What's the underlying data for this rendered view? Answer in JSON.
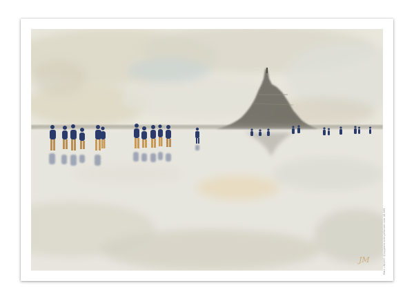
{
  "artwork": {
    "subject": "watercolor-mont-saint-michel-bay-walkers",
    "credit_text": "Matt LINDSEY  @juggeem  lorenyellonder.com  48 869",
    "signature": "JM",
    "palette": {
      "paper": "#ffffff",
      "sky": "#e4e0d2",
      "sky_blue": "#c9d2d3",
      "sand": "#e6e4dc",
      "warm_wash": "#ead9b6",
      "island": "#6e6b62",
      "walkers": "#2a3a6a",
      "sunlight": "#e8c07a"
    }
  }
}
